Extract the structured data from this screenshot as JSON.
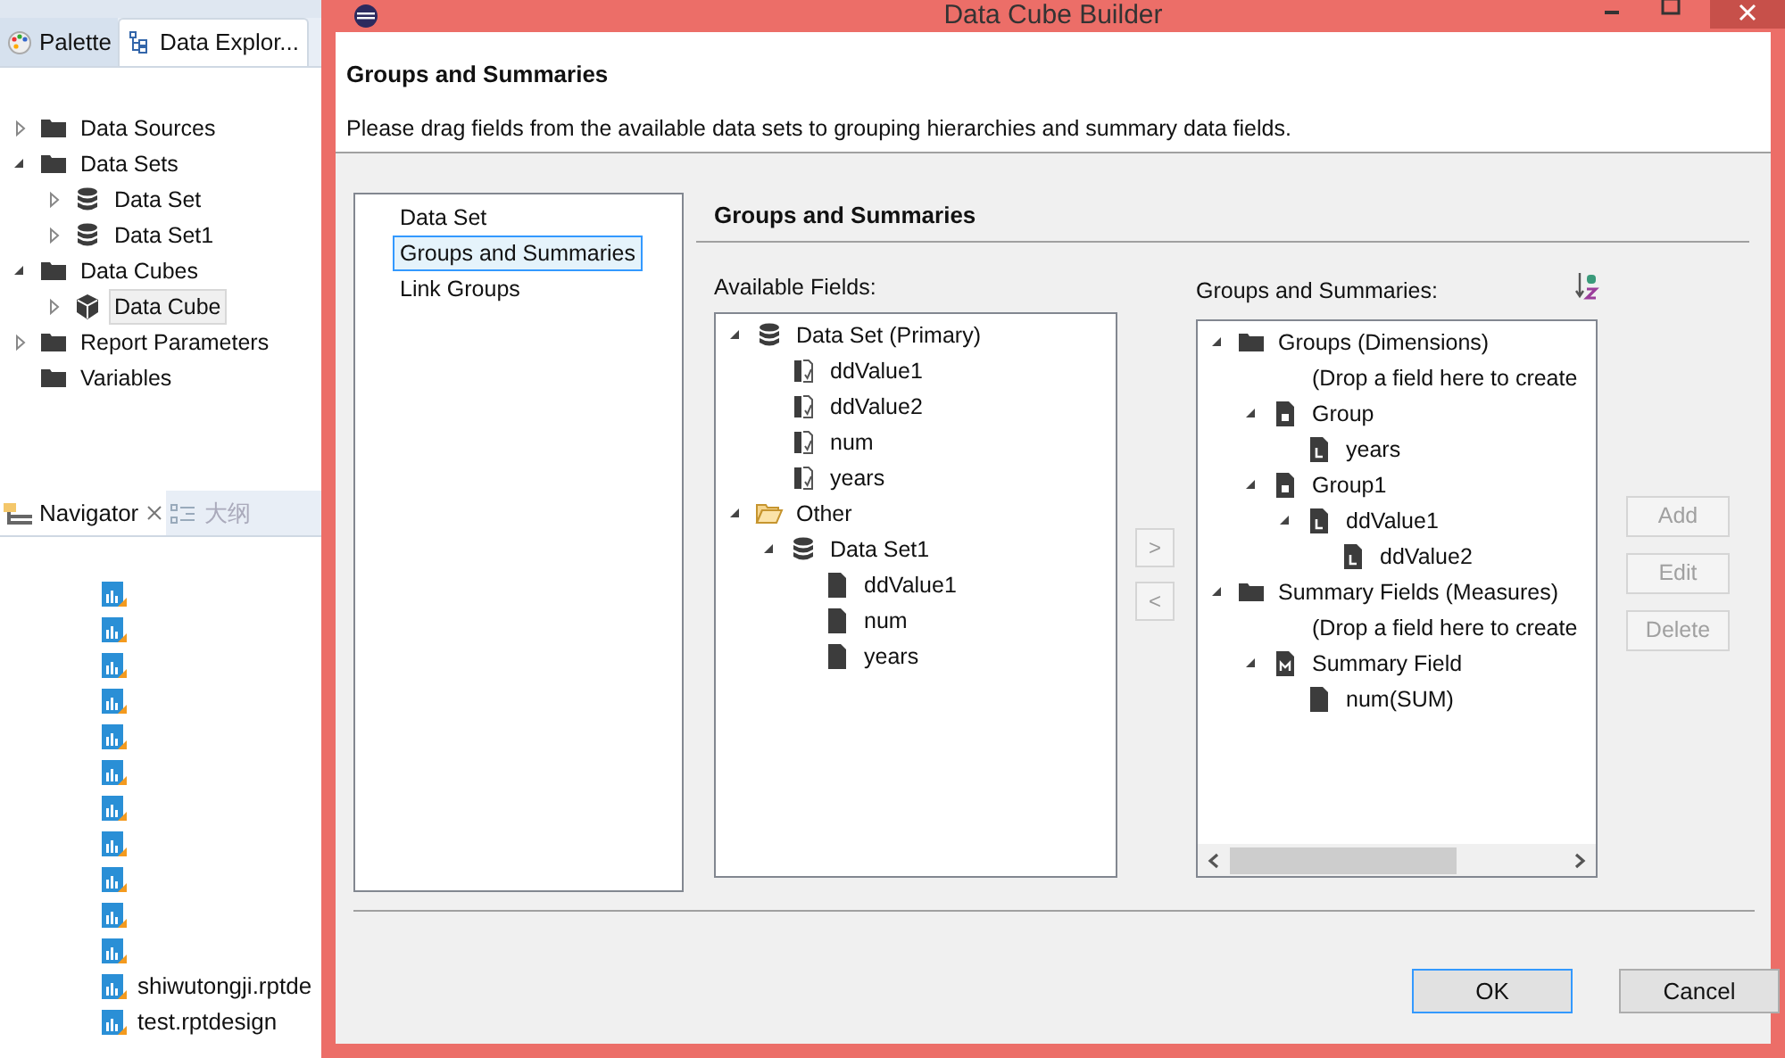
{
  "ide": {
    "tabs": [
      {
        "label": "Palette",
        "selected": false
      },
      {
        "label": "Data Explor...",
        "selected": true
      }
    ],
    "tree": [
      {
        "label": "Data Sources",
        "kind": "folder",
        "expanded": false,
        "selected": false
      },
      {
        "label": "Data Sets",
        "kind": "folder",
        "expanded": true,
        "selected": false,
        "children": [
          {
            "label": "Data Set",
            "kind": "database",
            "expanded": false,
            "selected": false
          },
          {
            "label": "Data Set1",
            "kind": "database",
            "expanded": false,
            "selected": false
          }
        ]
      },
      {
        "label": "Data Cubes",
        "kind": "folder",
        "expanded": true,
        "selected": false,
        "children": [
          {
            "label": "Data Cube",
            "kind": "cube",
            "expanded": false,
            "selected": true
          }
        ]
      },
      {
        "label": "Report Parameters",
        "kind": "folder",
        "expanded": false,
        "selected": false
      },
      {
        "label": "Variables",
        "kind": "folder",
        "selected": false
      }
    ],
    "navigator_tabs": [
      {
        "label": "Navigator",
        "selected": true
      },
      {
        "label": "大纲",
        "selected": false
      }
    ],
    "files": [
      {
        "kind": "obscured"
      },
      {
        "kind": "obscured"
      },
      {
        "kind": "obscured"
      },
      {
        "kind": "obscured"
      },
      {
        "kind": "obscured"
      },
      {
        "kind": "obscured"
      },
      {
        "kind": "obscured"
      },
      {
        "kind": "obscured"
      },
      {
        "kind": "obscured"
      },
      {
        "kind": "obscured"
      },
      {
        "kind": "obscured"
      },
      {
        "kind": "file",
        "label": "shiwutongji.rptde"
      },
      {
        "kind": "file",
        "label": "test.rptdesign"
      }
    ]
  },
  "dialog": {
    "title": "Data Cube Builder",
    "header": {
      "title": "Groups and Summaries",
      "description": "Please drag fields from the available data sets to grouping hierarchies and summary data fields."
    },
    "pages": [
      {
        "label": "Data Set",
        "selected": false
      },
      {
        "label": "Groups and Summaries",
        "selected": true
      },
      {
        "label": "Link Groups",
        "selected": false
      }
    ],
    "page_title": "Groups and Summaries",
    "available_fields": {
      "label": "Available Fields:",
      "tree": [
        {
          "label": "Data Set (Primary)",
          "kind": "database",
          "expanded": true,
          "children": [
            {
              "label": "ddValue1",
              "kind": "field"
            },
            {
              "label": "ddValue2",
              "kind": "field"
            },
            {
              "label": "num",
              "kind": "field"
            },
            {
              "label": "years",
              "kind": "field"
            }
          ]
        },
        {
          "label": "Other",
          "kind": "folder-open",
          "expanded": true,
          "children": [
            {
              "label": "Data Set1",
              "kind": "database",
              "expanded": true,
              "children": [
                {
                  "label": "ddValue1",
                  "kind": "file"
                },
                {
                  "label": "num",
                  "kind": "file"
                },
                {
                  "label": "years",
                  "kind": "file"
                }
              ]
            }
          ]
        }
      ]
    },
    "move_buttons": [
      ">",
      "<"
    ],
    "groups": {
      "label": "Groups and Summaries:",
      "tree": [
        {
          "label": "Groups (Dimensions)",
          "kind": "folder",
          "expanded": true,
          "children": [
            {
              "label": "(Drop a field here to create",
              "kind": "placeholder"
            },
            {
              "label": "Group",
              "kind": "dimension",
              "expanded": true,
              "children": [
                {
                  "label": "years",
                  "kind": "level"
                }
              ]
            },
            {
              "label": "Group1",
              "kind": "dimension",
              "expanded": true,
              "children": [
                {
                  "label": "ddValue1",
                  "kind": "level",
                  "expanded": true,
                  "children": [
                    {
                      "label": "ddValue2",
                      "kind": "level"
                    }
                  ]
                }
              ]
            }
          ]
        },
        {
          "label": "Summary Fields (Measures)",
          "kind": "folder",
          "expanded": true,
          "children": [
            {
              "label": "(Drop a field here to create",
              "kind": "placeholder"
            },
            {
              "label": "Summary Field",
              "kind": "measure",
              "expanded": true,
              "children": [
                {
                  "label": "num(SUM)",
                  "kind": "file"
                }
              ]
            }
          ]
        }
      ]
    },
    "side_buttons": [
      {
        "label": "Add",
        "disabled": true
      },
      {
        "label": "Edit",
        "disabled": true
      },
      {
        "label": "Delete",
        "disabled": true
      }
    ],
    "buttons": [
      {
        "label": "OK",
        "default": true
      },
      {
        "label": "Cancel",
        "default": false
      }
    ]
  }
}
